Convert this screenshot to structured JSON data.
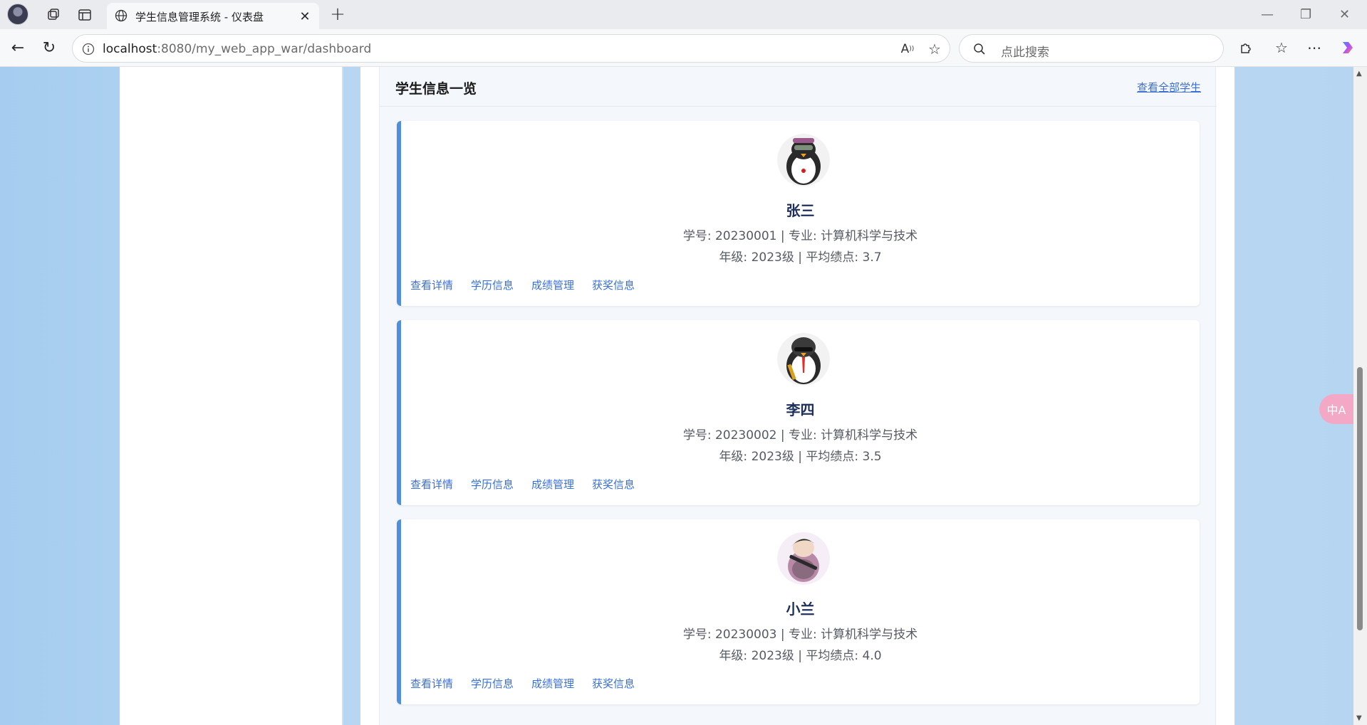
{
  "browser": {
    "tab_title": "学生信息管理系统 - 仪表盘",
    "url_host": "localhost",
    "url_path": ":8080/my_web_app_war/dashboard",
    "search_placeholder": "点此搜索"
  },
  "section": {
    "title": "学生信息一览",
    "view_all_label": "查看全部学生"
  },
  "students": [
    {
      "name": "张三",
      "line1": "学号: 20230001 | 专业: 计算机科学与技术",
      "line2": "年级: 2023级 | 平均绩点: 3.7",
      "actions": [
        "查看详情",
        "学历信息",
        "成绩管理",
        "获奖信息"
      ]
    },
    {
      "name": "李四",
      "line1": "学号: 20230002 | 专业: 计算机科学与技术",
      "line2": "年级: 2023级 | 平均绩点: 3.5",
      "actions": [
        "查看详情",
        "学历信息",
        "成绩管理",
        "获奖信息"
      ]
    },
    {
      "name": "小兰",
      "line1": "学号: 20230003 | 专业: 计算机科学与技术",
      "line2": "年级: 2023级 | 平均绩点: 4.0",
      "actions": [
        "查看详情",
        "学历信息",
        "成绩管理",
        "获奖信息"
      ]
    }
  ],
  "translate_button": "中A",
  "colors": {
    "accent": "#4f8fdb",
    "link": "#3a6fd8",
    "background_blue": "#b5d5f1",
    "translate_pink": "#f3a9c5"
  },
  "icons": [
    "profile-avatar",
    "collections-icon",
    "tab-actions-icon",
    "globe-icon",
    "close-icon",
    "new-tab-icon",
    "minimize-icon",
    "maximize-icon",
    "window-close-icon",
    "back-icon",
    "refresh-icon",
    "site-info-icon",
    "read-aloud-icon",
    "favorite-icon",
    "search-icon",
    "extensions-icon",
    "favorites-icon",
    "more-icon",
    "copilot-icon"
  ]
}
